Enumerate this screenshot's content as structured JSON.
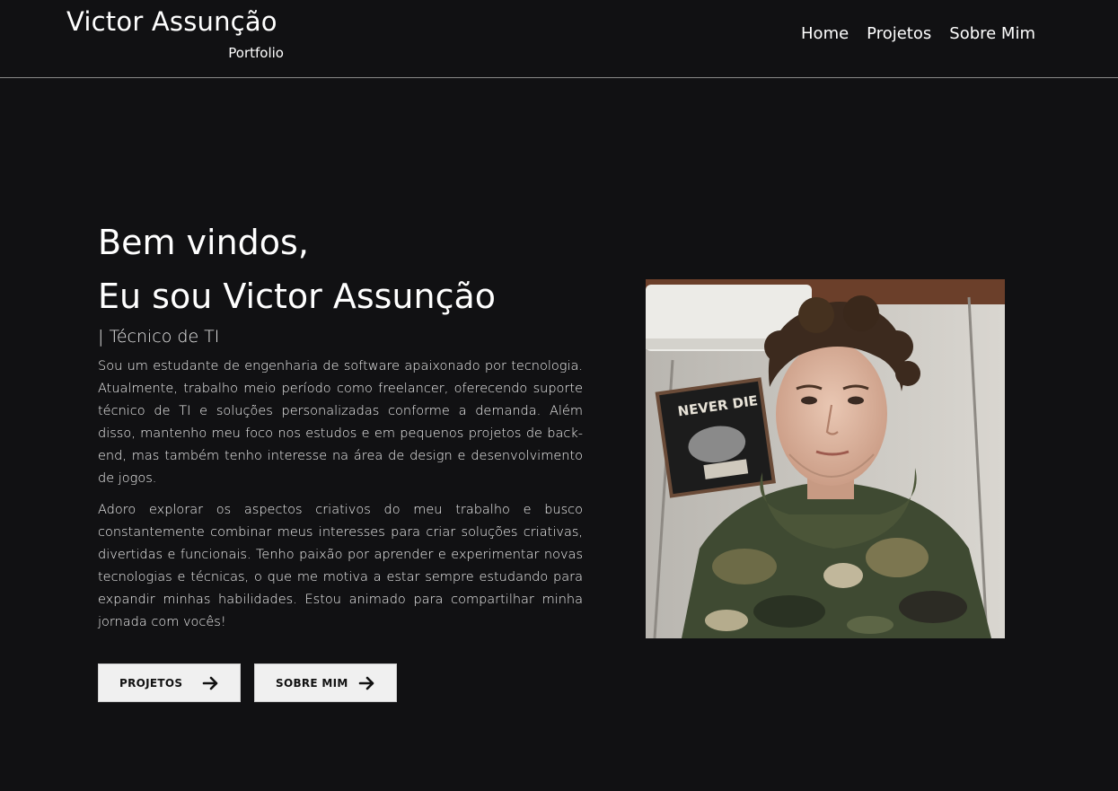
{
  "header": {
    "brand_name": "Victor Assunção",
    "brand_sub": "Portfolio",
    "nav": [
      "Home",
      "Projetos",
      "Sobre Mim"
    ]
  },
  "hero": {
    "greeting_line1": "Bem vindos,",
    "greeting_line2": "Eu sou Victor Assunção",
    "role": "| Técnico de TI",
    "paragraph1": "Sou um estudante de engenharia de software apaixonado por tecnologia. Atualmente, trabalho meio período como freelancer, oferecendo suporte técnico de TI e soluções personalizadas conforme a demanda. Além disso, mantenho meu foco nos estudos e em pequenos projetos de back-end, mas também tenho interesse na área de design e desenvolvimento de jogos.",
    "paragraph2": "Adoro explorar os aspectos criativos do meu trabalho e busco constantemente combinar meus interesses para criar soluções criativas, divertidas e funcionais. Tenho paixão por aprender e experimentar novas tecnologias e técnicas, o que me motiva a estar sempre estudando para expandir minhas habilidades. Estou animado para compartilhar minha jornada com vocês!",
    "buttons": [
      {
        "label": "PROJETOS",
        "icon": "arrow-right-icon"
      },
      {
        "label": "SOBRE MIM",
        "icon": "arrow-right-icon"
      }
    ],
    "photo_sign_text": "NEVER DIE"
  },
  "colors": {
    "background": "#111113",
    "text": "#ffffff",
    "button_bg": "#f0f0f0",
    "divider": "#8a8a8a"
  }
}
